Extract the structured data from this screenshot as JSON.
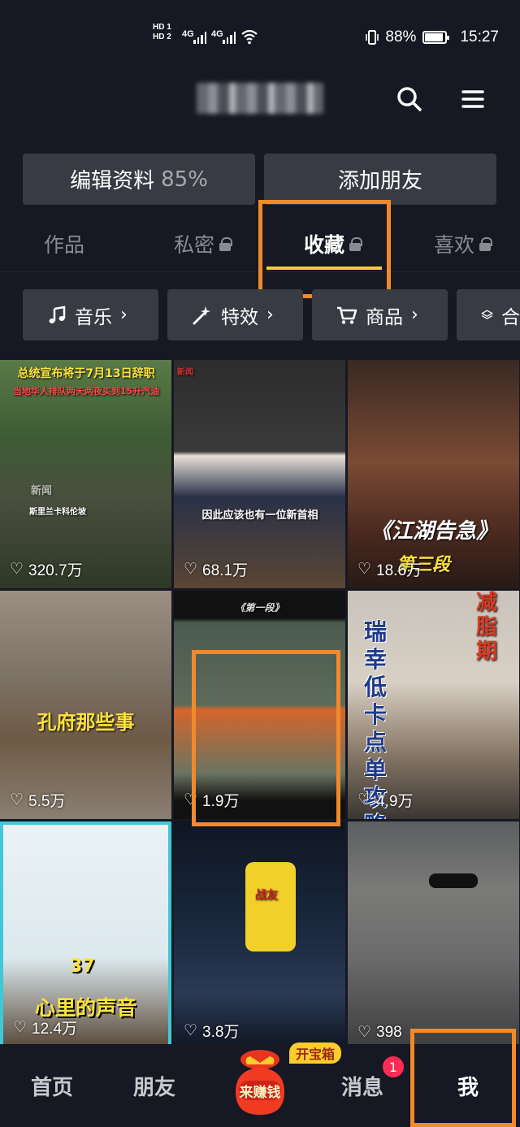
{
  "status_bar": {
    "sim1": "HD 1",
    "sim2": "HD 2",
    "signal1": "4G",
    "signal2": "4G",
    "battery": "88%",
    "battery_level": 0.88,
    "time": "15:27"
  },
  "header": {
    "search_icon": "search-icon",
    "menu_icon": "menu-icon"
  },
  "actions": {
    "edit_profile": "编辑资料",
    "edit_percent": "85%",
    "add_friend": "添加朋友"
  },
  "tabs": [
    {
      "label": "作品",
      "locked": false
    },
    {
      "label": "私密",
      "locked": true
    },
    {
      "label": "收藏",
      "locked": true,
      "active": true
    },
    {
      "label": "喜欢",
      "locked": true
    }
  ],
  "categories": [
    {
      "label": "音乐",
      "icon": "music-note-icon"
    },
    {
      "label": "特效",
      "icon": "magic-wand-icon"
    },
    {
      "label": "商品",
      "icon": "cart-icon"
    },
    {
      "label": "合",
      "icon": "layers-icon"
    }
  ],
  "videos": [
    {
      "likes": "320.7万",
      "overlay1": "总统宣布将于7月13日辞职",
      "overlay2": "当地华人排队两天两夜买到15升汽油",
      "caption": "斯里兰卡科伦坡",
      "tag": "新闻"
    },
    {
      "likes": "68.1万",
      "overlay1": "因此应该也有一位新首相",
      "tag": "新闻"
    },
    {
      "likes": "18.6万",
      "overlay1": "《江湖告急》",
      "overlay2": "第三段"
    },
    {
      "likes": "5.5万",
      "overlay1": "孔府那些事"
    },
    {
      "likes": "1.9万",
      "overlay1": "《第一段》"
    },
    {
      "likes": "4.9万",
      "overlay1": "瑞幸低卡点单攻略",
      "overlay2": "减脂期"
    },
    {
      "likes": "12.4万",
      "overlay1": "心里的声音",
      "overlay2": "37"
    },
    {
      "likes": "3.8万",
      "overlay1": "战友"
    },
    {
      "likes": "398"
    }
  ],
  "bottom_nav": {
    "home": "首页",
    "friends": "朋友",
    "earn": "来赚钱",
    "earn_badge": "开宝箱",
    "messages": "消息",
    "messages_badge": "1",
    "me": "我"
  },
  "colors": {
    "background": "#161823",
    "button": "#393b44",
    "tab_indicator": "#fbcc2c",
    "highlight": "#f2892a",
    "badge": "#fe2c55"
  }
}
